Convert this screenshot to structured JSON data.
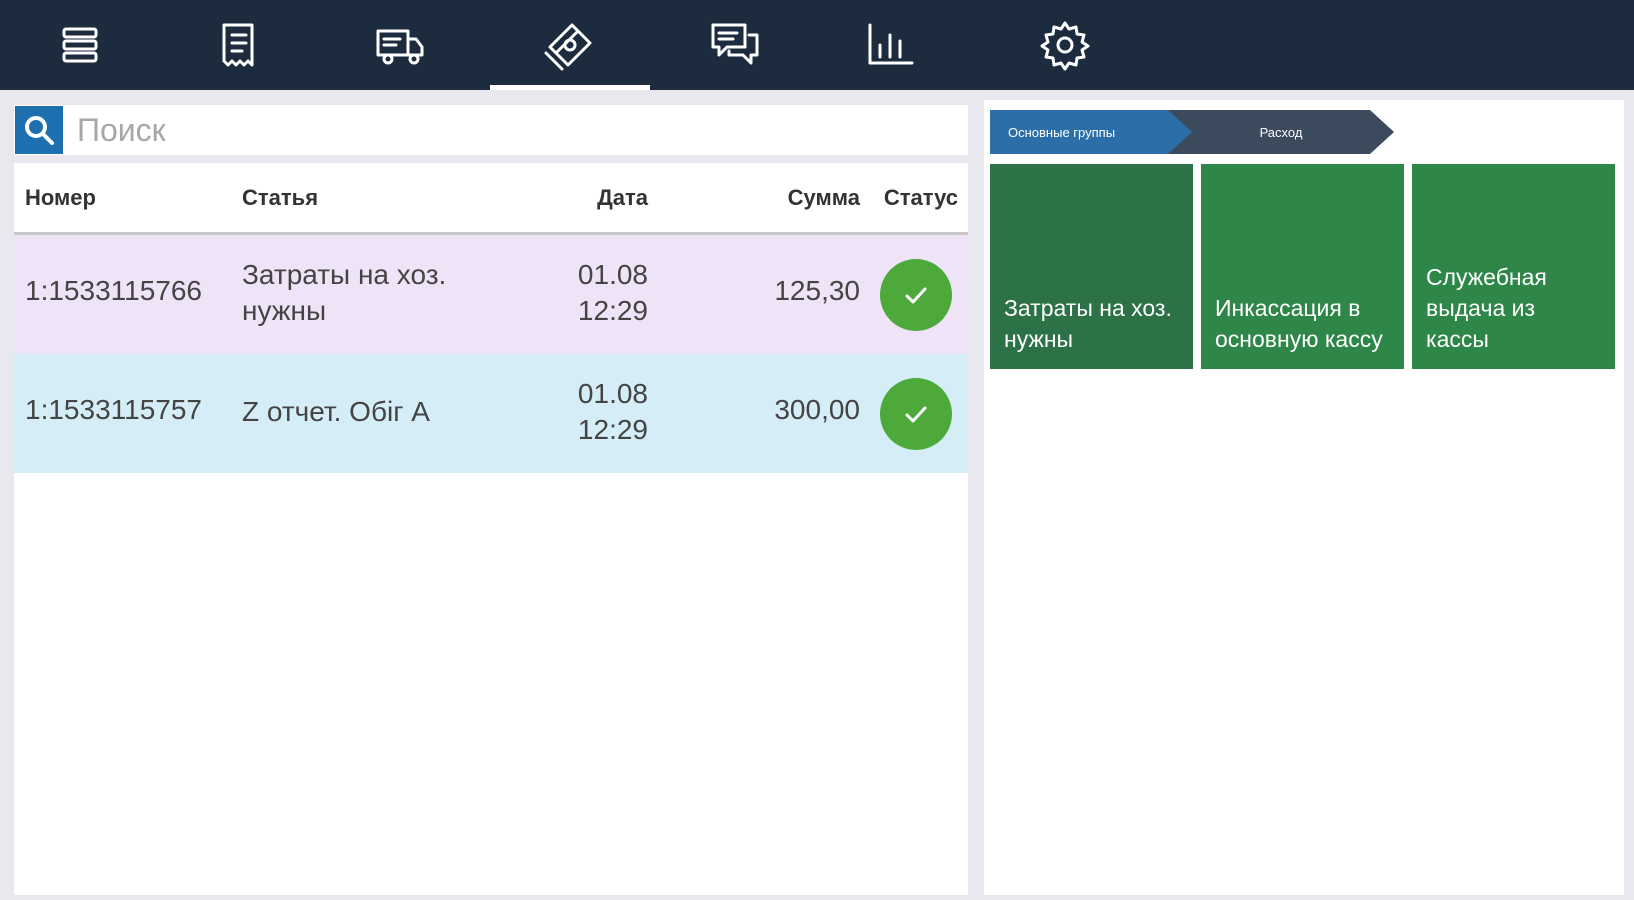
{
  "nav": {
    "tabs": [
      {
        "name": "menu",
        "icon": "menu-icon"
      },
      {
        "name": "receipts",
        "icon": "receipt-icon"
      },
      {
        "name": "delivery",
        "icon": "delivery-truck-icon"
      },
      {
        "name": "cash",
        "icon": "money-icon",
        "active": true
      },
      {
        "name": "messages",
        "icon": "chat-icon"
      },
      {
        "name": "reports",
        "icon": "bar-chart-icon"
      },
      {
        "name": "settings",
        "icon": "gear-icon"
      }
    ]
  },
  "search": {
    "placeholder": "Поиск"
  },
  "table": {
    "headers": {
      "number": "Номер",
      "article": "Статья",
      "date": "Дата",
      "sum": "Сумма",
      "status": "Статус"
    },
    "rows": [
      {
        "number": "1:1533115766",
        "article": "Затраты на хоз. нужны",
        "date_day": "01.08",
        "date_time": "12:29",
        "sum": "125,30",
        "status": "done",
        "bg": "#efe3f8"
      },
      {
        "number": "1:1533115757",
        "article": "Z отчет. Обіг А",
        "date_day": "01.08",
        "date_time": "12:29",
        "sum": "300,00",
        "status": "done",
        "bg": "#d5edf7"
      }
    ]
  },
  "breadcrumbs": [
    {
      "label": "Основные группы"
    },
    {
      "label": "Расход"
    }
  ],
  "tiles": [
    {
      "label": "Затраты на хоз. нужны"
    },
    {
      "label": "Инкассация в основную кассу"
    },
    {
      "label": "Служебная выдача из кассы"
    }
  ],
  "colors": {
    "topbar": "#1c2b3d",
    "accent_blue": "#1e6fb0",
    "status_green": "#4ca93a",
    "tile_green": "#2e8748"
  }
}
